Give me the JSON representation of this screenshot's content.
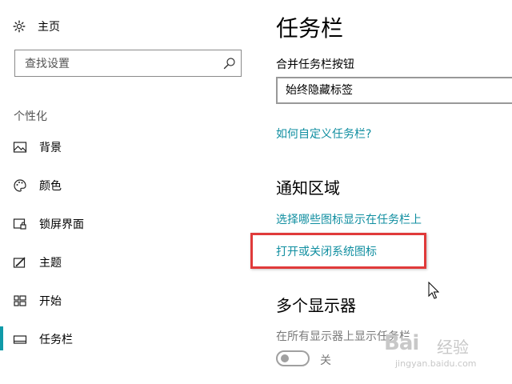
{
  "sidebar": {
    "home_label": "主页",
    "search_placeholder": "查找设置",
    "section_title": "个性化",
    "items": [
      {
        "label": "背景",
        "icon": "picture-icon"
      },
      {
        "label": "颜色",
        "icon": "palette-icon"
      },
      {
        "label": "锁屏界面",
        "icon": "lock-screen-icon"
      },
      {
        "label": "主题",
        "icon": "theme-icon"
      },
      {
        "label": "开始",
        "icon": "start-icon"
      },
      {
        "label": "任务栏",
        "icon": "taskbar-icon",
        "active": true
      }
    ],
    "accent_color": "#0f9aa8"
  },
  "main": {
    "title": "任务栏",
    "combine_label": "合并任务栏按钮",
    "combine_value": "始终隐藏标签",
    "customize_link": "如何自定义任务栏?",
    "notification_heading": "通知区域",
    "select_icons_link": "选择哪些图标显示在任务栏上",
    "system_icons_link": "打开或关闭系统图标",
    "multi_display_heading": "多个显示器",
    "show_all_label": "在所有显示器上显示任务栏",
    "toggle_state": "关",
    "link_color": "#0f8ea0",
    "highlight_color": "#e03a3a"
  },
  "watermark": {
    "logo": "Bai",
    "text": "经验",
    "url": "jingyan.baidu.com"
  }
}
